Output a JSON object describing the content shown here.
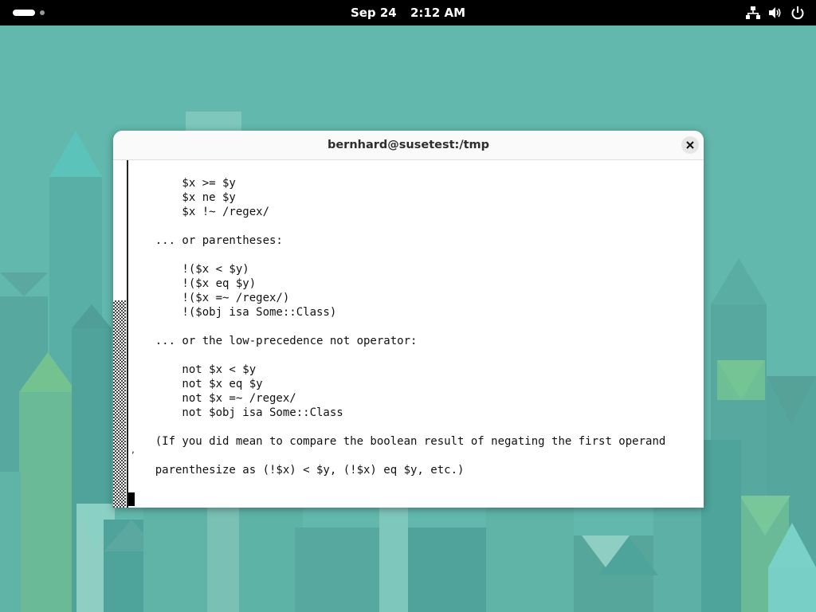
{
  "topbar": {
    "date": "Sep 24",
    "time": "2:12 AM"
  },
  "terminal": {
    "title": "bernhard@susetest:/tmp",
    "lines": [
      "        $x >= $y",
      "        $x ne $y",
      "        $x !~ /regex/",
      "",
      "    ... or parentheses:",
      "",
      "        !($x < $y)",
      "        !($x eq $y)",
      "        !($x =~ /regex/)",
      "        !($obj isa Some::Class)",
      "",
      "    ... or the low-precedence not operator:",
      "",
      "        not $x < $y",
      "        not $x eq $y",
      "        not $x =~ /regex/",
      "        not $obj isa Some::Class",
      "",
      "    (If you did mean to compare the boolean result of negating the first operand",
      "",
      "    parenthesize as (!$x) < $y, (!$x) eq $y, etc.)"
    ],
    "stray_char": ","
  }
}
